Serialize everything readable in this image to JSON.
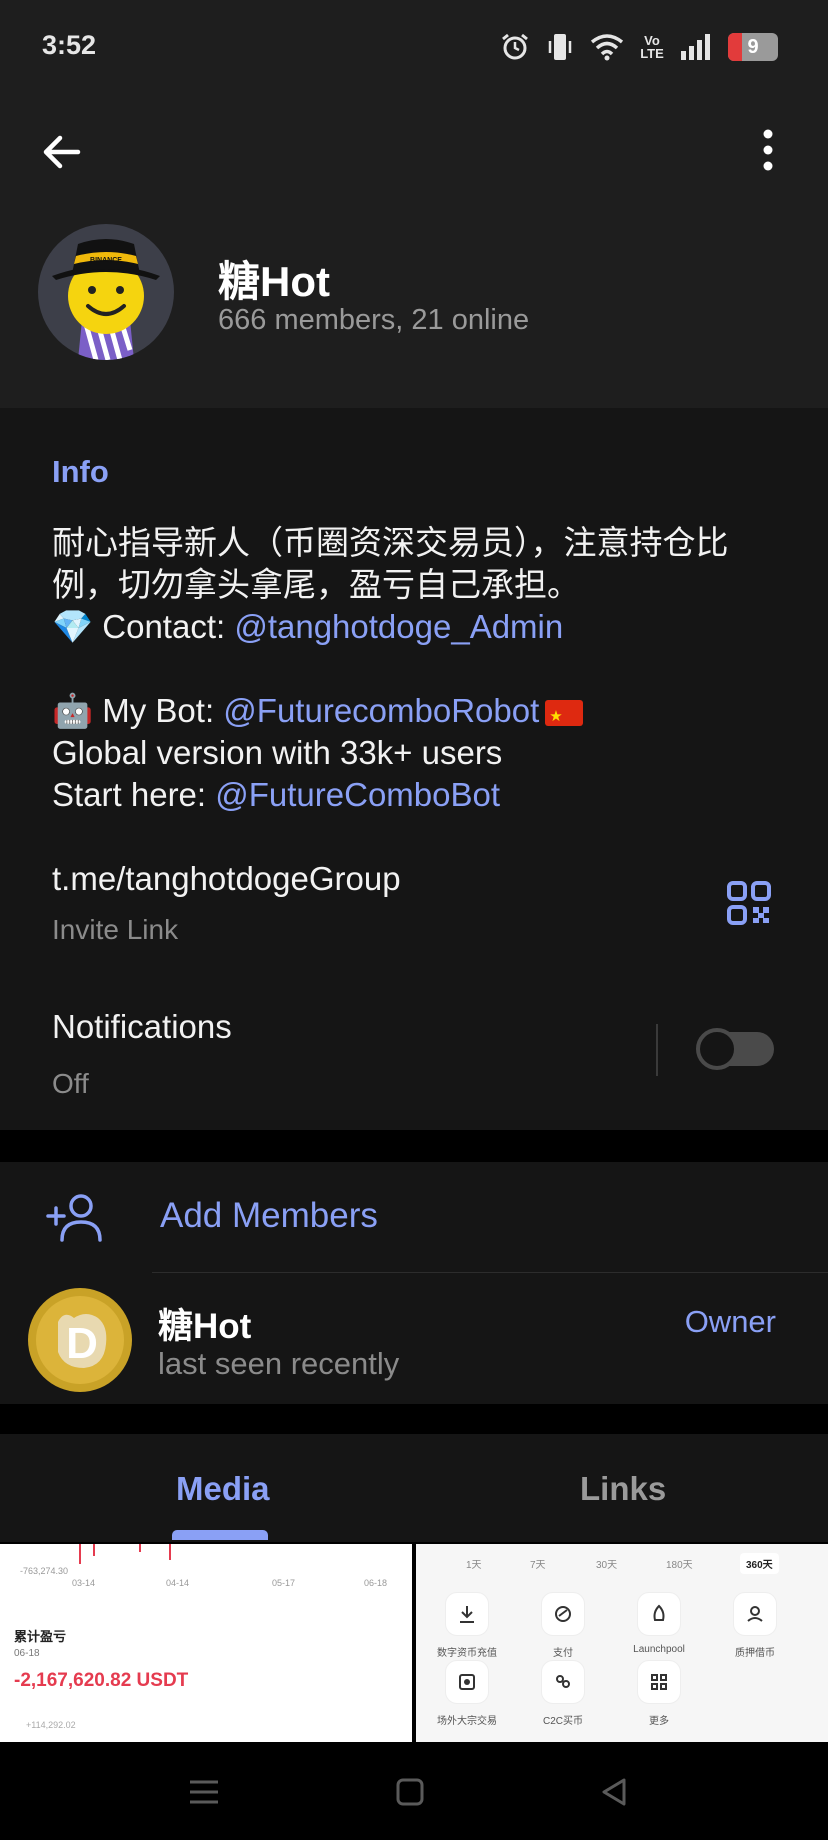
{
  "status_bar": {
    "time": "3:52",
    "battery_level": "9",
    "battery_fraction": 0.09,
    "icons": [
      "alarm-icon",
      "vibrate-icon",
      "wifi-icon",
      "volte-icon",
      "signal-icon",
      "battery-icon"
    ],
    "volte_text": "Vo LTE"
  },
  "header": {
    "group_name": "糖Hot",
    "group_status": "666 members, 21 online",
    "avatar_badge": "BINANCE"
  },
  "info": {
    "section_title": "Info",
    "description_line1": "耐心指导新人（币圈资深交易员），注意持仓比例，切勿拿头拿尾，盈亏自己承担。",
    "contact_prefix": "💎 Contact: ",
    "contact_handle": "@tanghotdoge_Admin",
    "bot_prefix": "🤖 My Bot: ",
    "bot_handle": "@FuturecomboRobot",
    "global_line": "Global version with 33k+ users",
    "start_prefix": "Start here: ",
    "start_handle": "@FutureComboBot",
    "invite_link": "t.me/tanghotdogeGroup",
    "invite_label": "Invite Link",
    "notifications_label": "Notifications",
    "notifications_value": "Off"
  },
  "members": {
    "add_label": "Add Members",
    "member_name": "糖Hot",
    "member_status": "last seen recently",
    "member_role": "Owner"
  },
  "tabs": {
    "media": "Media",
    "links": "Links"
  },
  "thumb1": {
    "axis_top": "-763,274.30",
    "dates": [
      "03-14",
      "04-14",
      "05-17",
      "06-18"
    ],
    "title": "累计盈亏",
    "date": "06-18",
    "value": "-2,167,620.82 USDT",
    "low": "+114,292.02"
  },
  "thumb2": {
    "periods": [
      "1天",
      "7天",
      "30天",
      "180天",
      "360天"
    ],
    "items": [
      "数字资币充值",
      "支付",
      "Launchpool",
      "质押借币",
      "场外大宗交易",
      "C2C买币",
      "更多"
    ]
  },
  "colors": {
    "accent": "#8aa0f5",
    "header_bg": "#1e1e1e",
    "section_bg": "#151515",
    "loss_red": "#e53b4f"
  }
}
